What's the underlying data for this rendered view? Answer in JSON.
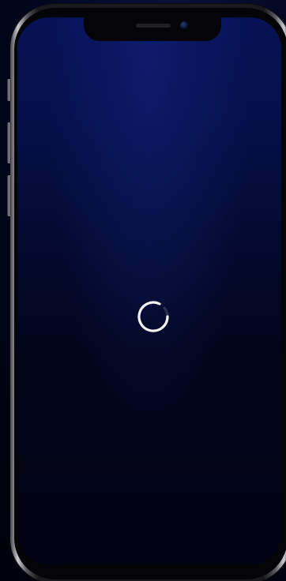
{
  "device": {
    "model_icon": "iphone-frame-icon"
  },
  "screen": {
    "state": "loading",
    "spinner_icon": "loading-spinner-icon"
  },
  "colors": {
    "screen_top": "#061255",
    "screen_bottom": "#010213",
    "spinner": "#ffffff"
  }
}
